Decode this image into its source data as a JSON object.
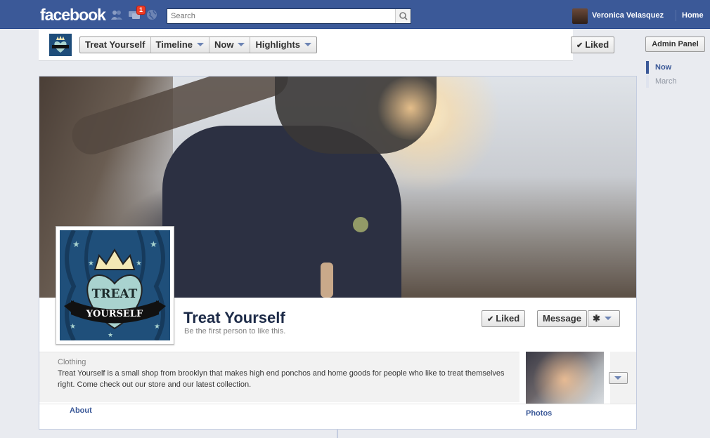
{
  "topbar": {
    "logo": "facebook",
    "notification_count": "1",
    "search_placeholder": "Search",
    "user_name": "Veronica Velasquez",
    "home_label": "Home"
  },
  "page_nav": {
    "tabs": [
      {
        "label": "Treat Yourself"
      },
      {
        "label": "Timeline"
      },
      {
        "label": "Now"
      },
      {
        "label": "Highlights"
      }
    ],
    "liked_label": "Liked"
  },
  "sidebar": {
    "admin_label": "Admin Panel",
    "timeline_items": [
      {
        "label": "Now",
        "active": true
      },
      {
        "label": "March",
        "active": false
      }
    ]
  },
  "profile": {
    "name": "Treat Yourself",
    "subline": "Be the first person to like this.",
    "liked_label": "Liked",
    "message_label": "Message",
    "logo_text_top": "TREAT",
    "logo_text_bottom": "YOURSELF"
  },
  "about": {
    "category": "Clothing",
    "description": "Treat Yourself is a small shop from brooklyn that makes high end ponchos and home goods for people who like to treat themselves right. Come check out our store and our latest collection.",
    "about_link": "About",
    "photos_link": "Photos"
  },
  "colors": {
    "brand_blue": "#3b5998",
    "notification_red": "#f03d25",
    "logo_navy": "#1f4f7a"
  }
}
